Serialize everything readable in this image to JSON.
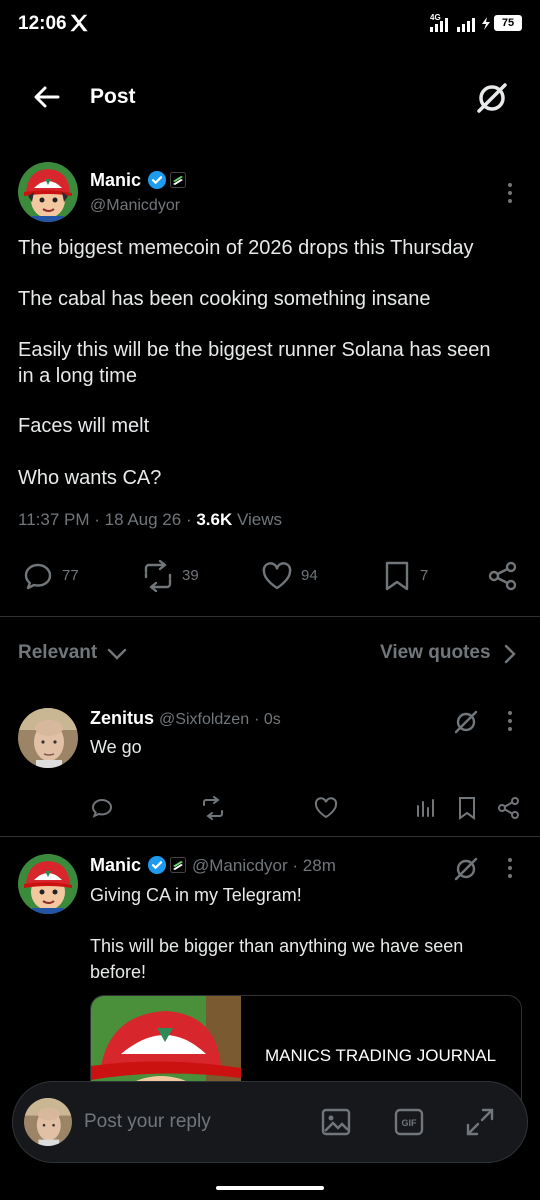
{
  "status": {
    "time": "12:06",
    "network": "4G",
    "battery": "75"
  },
  "header": {
    "title": "Post"
  },
  "post": {
    "author": "Manic",
    "handle": "@Manicdyor",
    "lines": [
      "The biggest memecoin of 2026 drops this Thursday",
      "The cabal has been cooking something insane",
      "Easily this will be the biggest runner Solana has seen",
      "in a long time",
      "Faces will melt",
      "Who wants CA?"
    ],
    "time": "11:37 PM",
    "date": "18 Aug 26",
    "views_count": "3.6K",
    "views_label": "Views",
    "replies": "77",
    "reposts": "39",
    "likes": "94",
    "bookmarks": "7"
  },
  "filter": {
    "label": "Relevant",
    "view_quotes": "View quotes"
  },
  "replies": [
    {
      "author": "Zenitus",
      "handle": "@Sixfoldzen",
      "time": "· 0s",
      "text": "We go"
    },
    {
      "author": "Manic",
      "handle": "@Manicdyor",
      "time": "· 28m",
      "text1": "Giving CA in my Telegram!",
      "text2": "This will be bigger than anything we have seen",
      "text3": "before!",
      "card_title": "MANICS TRADING JOURNAL"
    }
  ],
  "composer": {
    "placeholder": "Post your reply"
  },
  "colors": {
    "background": "#000000",
    "muted": "#71767b",
    "verified": "#1d9bf0"
  }
}
